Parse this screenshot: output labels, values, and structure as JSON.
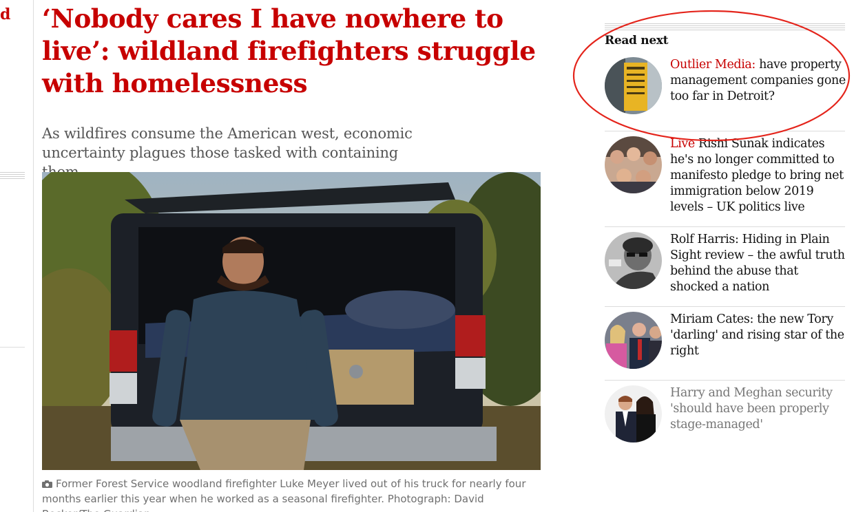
{
  "left_fragment": "d",
  "article": {
    "headline": "‘Nobody cares I have nowhere to live’: wildland firefighters struggle with homelessness",
    "standfirst": "As wildfires consume the American west, economic uncertainty plagues those tasked with containing them",
    "caption": "Former Forest Service woodland firefighter Luke Meyer lived out of his truck for nearly four months earlier this year when he worked as a seasonal firefighter. Photograph: David Becker/The Guardian"
  },
  "read_next": {
    "title": "Read next",
    "items": [
      {
        "kicker": "Outlier Media:",
        "text": " have property management companies gone too far in Detroit?",
        "thumb_icon": "parking-sign-thumbnail"
      },
      {
        "kicker": "Live",
        "text": " Rishi Sunak indicates he's no longer committed to manifesto pledge to bring net immigration below 2019 levels – UK politics live",
        "thumb_icon": "crowd-thumbnail"
      },
      {
        "kicker": "",
        "text": "Rolf Harris: Hiding in Plain Sight review – the awful truth behind the abuse that shocked a nation",
        "thumb_icon": "portrait-bw-thumbnail"
      },
      {
        "kicker": "",
        "text": "Miriam Cates: the new Tory 'darling' and rising star of the right",
        "thumb_icon": "politicians-thumbnail"
      },
      {
        "kicker": "",
        "text": "Harry and Meghan security 'should have been properly stage-managed'",
        "thumb_icon": "couple-thumbnail"
      }
    ]
  },
  "colors": {
    "headline": "#c70000",
    "kicker": "#c70000",
    "annotation_circle": "#e4241b"
  }
}
